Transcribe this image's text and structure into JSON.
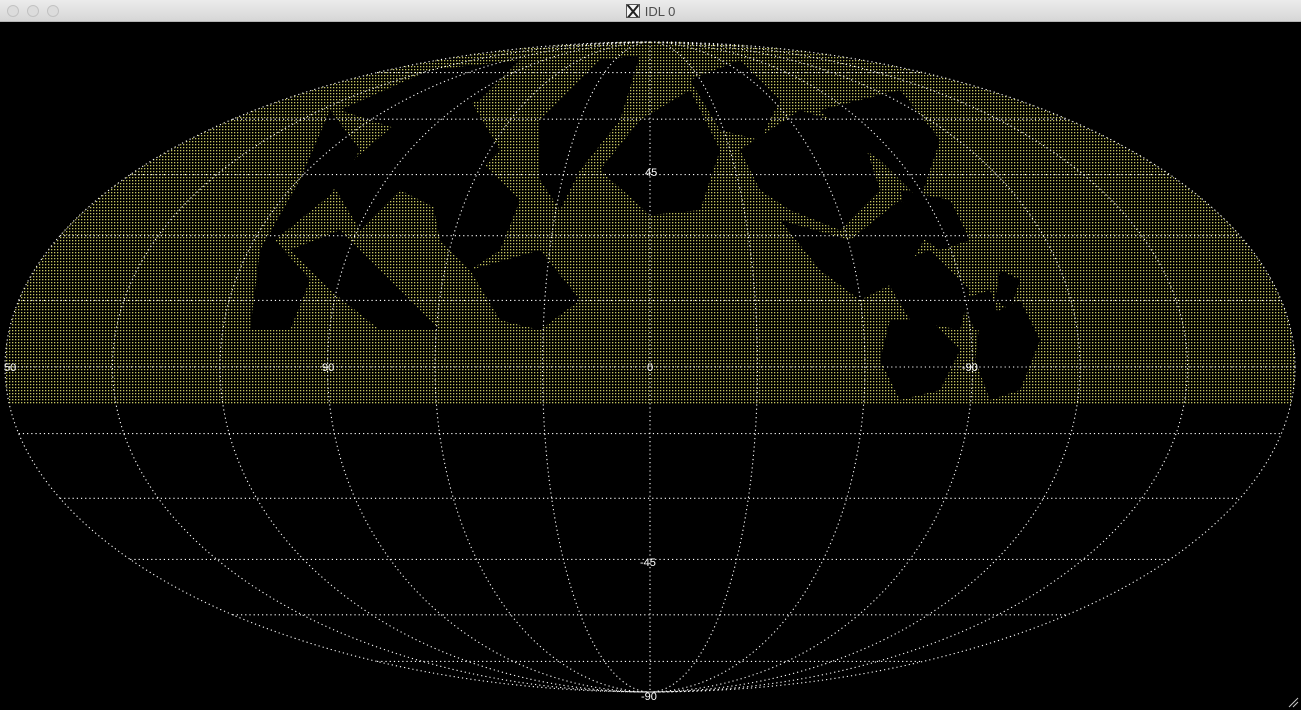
{
  "window": {
    "title": "IDL 0",
    "icon": "x11-icon"
  },
  "map": {
    "projection": "mollweide",
    "background": "#000000",
    "grid_color": "#ffffff",
    "fill_color": "#e8e870",
    "fill_region": "northern-hemisphere-except-continents",
    "lon_labels": [
      "50",
      "90",
      "0",
      "-90"
    ],
    "lat_labels": [
      "45",
      "-45",
      "-90"
    ]
  }
}
